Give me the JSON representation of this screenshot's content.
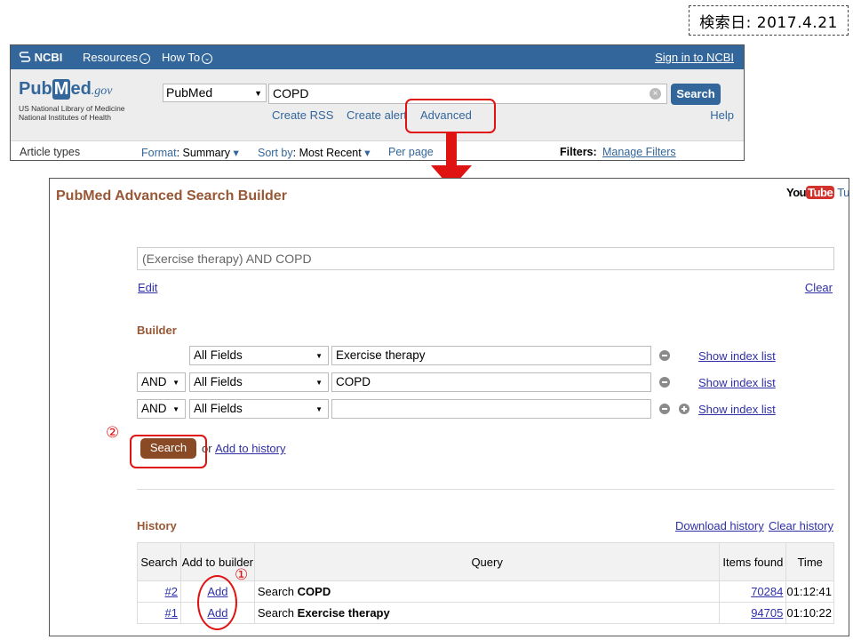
{
  "search_date": "検索日: 2017.4.21",
  "ncbi": {
    "logo": "NCBI",
    "menu_resources": "Resources",
    "menu_howto": "How To",
    "sign_in": "Sign in to NCBI"
  },
  "pubmed": {
    "logo_pub": "Pub",
    "logo_m": "M",
    "logo_ed": "ed",
    "logo_gov": ".gov",
    "library_line1": "US National Library of Medicine",
    "library_line2": "National Institutes of Health",
    "database": "PubMed",
    "query": "COPD",
    "search_button": "Search",
    "create_rss": "Create RSS",
    "create_alert": "Create alert",
    "advanced": "Advanced",
    "help": "Help",
    "article_types": "Article types",
    "format_label": "Format",
    "format_value": "Summary",
    "sort_label": "Sort by",
    "sort_value": "Most Recent",
    "per_page": "Per page",
    "filters_label": "Filters:",
    "manage_filters": "Manage Filters"
  },
  "advanced": {
    "title": "PubMed Advanced Search Builder",
    "youtube_you": "You",
    "youtube_tube": "Tube",
    "youtube_tu": "Tu",
    "query_box": "(Exercise therapy) AND COPD",
    "edit": "Edit",
    "clear": "Clear",
    "builder_label": "Builder",
    "rows": [
      {
        "operator": "",
        "field": "All Fields",
        "term": "Exercise therapy",
        "index_link": "Show index list"
      },
      {
        "operator": "AND",
        "field": "All Fields",
        "term": "COPD",
        "index_link": "Show index list"
      },
      {
        "operator": "AND",
        "field": "All Fields",
        "term": "",
        "index_link": "Show index list"
      }
    ],
    "search_button": "Search",
    "or": "or",
    "add_to_history": "Add to history",
    "history_label": "History",
    "download_history": "Download history",
    "clear_history": "Clear history",
    "table_headers": {
      "search": "Search",
      "add_to_builder": "Add to builder",
      "query": "Query",
      "items_found": "Items found",
      "time": "Time"
    },
    "history_rows": [
      {
        "num": "#2",
        "add": "Add",
        "query_prefix": "Search",
        "query_term": "COPD",
        "items": "70284",
        "time": "01:12:41"
      },
      {
        "num": "#1",
        "add": "Add",
        "query_prefix": "Search",
        "query_term": "Exercise therapy",
        "items": "94705",
        "time": "01:10:22"
      }
    ]
  },
  "annotations": {
    "marker_1": "①",
    "marker_2": "②",
    "highlight_color": "#e01313"
  },
  "colors": {
    "ncbi_bar": "#33669a",
    "title_brown": "#985735",
    "button_brown": "#8b4a26"
  }
}
